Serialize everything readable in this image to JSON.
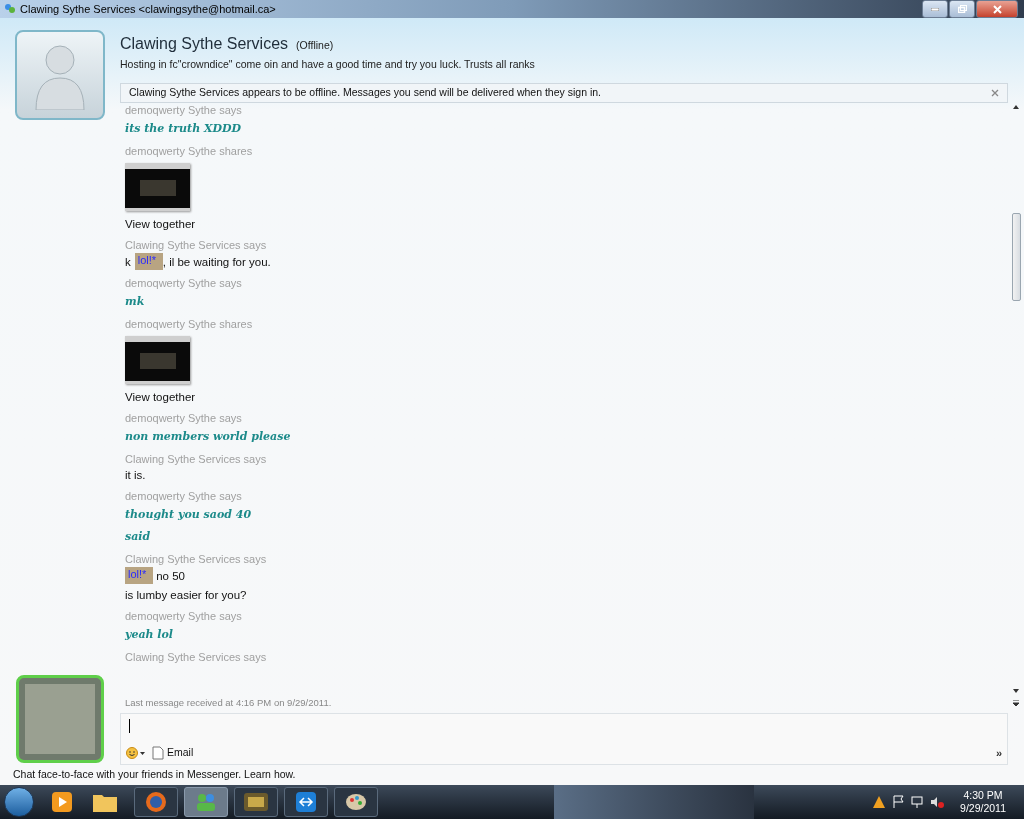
{
  "window": {
    "title": "Clawing Sythe Services <clawingsythe@hotmail.ca>"
  },
  "contact": {
    "name": "Clawing Sythe Services",
    "status": "(Offline)",
    "personal_message": "Hosting in fc\"crowndice\" come oin and have a good time and try you luck. Trusts all ranks"
  },
  "notice": {
    "text": "Clawing Sythe Services appears to be offline. Messages you send will be delivered when they sign in."
  },
  "messages": [
    {
      "header": "demoqwerty Sythe says",
      "lines": [
        {
          "kind": "styled",
          "text": "its the truth XDDD"
        }
      ]
    },
    {
      "header": "demoqwerty Sythe shares",
      "lines": [
        {
          "kind": "share",
          "text": "View together"
        }
      ]
    },
    {
      "header": "Clawing Sythe Services says",
      "lines": [
        {
          "kind": "emote",
          "prefix": "k",
          "emoticon": "lol!*",
          "text": ", il be waiting for you."
        }
      ]
    },
    {
      "header": "demoqwerty Sythe says",
      "lines": [
        {
          "kind": "styled",
          "text": "mk"
        }
      ]
    },
    {
      "header": "demoqwerty Sythe shares",
      "lines": [
        {
          "kind": "share",
          "text": "View together"
        }
      ]
    },
    {
      "header": "demoqwerty Sythe says",
      "lines": [
        {
          "kind": "styled",
          "text": "non members world please"
        }
      ]
    },
    {
      "header": "Clawing Sythe Services says",
      "lines": [
        {
          "kind": "plain",
          "text": "it is."
        }
      ]
    },
    {
      "header": "demoqwerty Sythe says",
      "lines": [
        {
          "kind": "styled",
          "text": "thought you saod 40"
        },
        {
          "kind": "styled",
          "text": "said"
        }
      ]
    },
    {
      "header": "Clawing Sythe Services says",
      "lines": [
        {
          "kind": "emote",
          "emoticon": "lol!*",
          "text": " no 50"
        },
        {
          "kind": "plain",
          "text": "is lumby easier for you?"
        }
      ]
    },
    {
      "header": "demoqwerty Sythe says",
      "lines": [
        {
          "kind": "styled",
          "text": "yeah lol"
        }
      ]
    },
    {
      "header": "Clawing Sythe Services says"
    }
  ],
  "last_received": "Last message received at 4:16 PM on 9/29/2011.",
  "toolbar": {
    "email": "Email",
    "more": "»"
  },
  "promo": "Chat face-to-face with your friends in Messenger. Learn how.",
  "clock": {
    "time": "4:30 PM",
    "date": "9/29/2011"
  }
}
